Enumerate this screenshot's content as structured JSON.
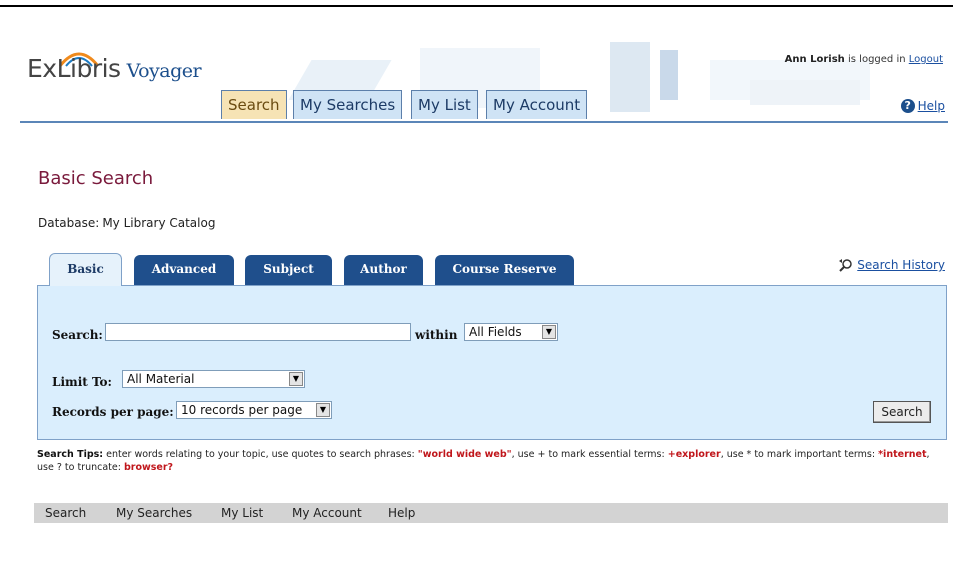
{
  "header": {
    "logo_exlibris": "ExLibris",
    "logo_voyager": "Voyager",
    "login_user": "Ann Lorish",
    "login_text": "is logged in",
    "logout_link": "Logout",
    "help_link": "Help",
    "tabs": [
      {
        "label": "Search",
        "active": true
      },
      {
        "label": "My Searches",
        "active": false
      },
      {
        "label": "My List",
        "active": false
      },
      {
        "label": "My Account",
        "active": false
      }
    ]
  },
  "main": {
    "title": "Basic Search",
    "database_label": "Database:",
    "database_value": "My Library Catalog",
    "search_history_link": "Search History",
    "form_tabs": [
      {
        "label": "Basic",
        "active": true
      },
      {
        "label": "Advanced",
        "active": false
      },
      {
        "label": "Subject",
        "active": false
      },
      {
        "label": "Author",
        "active": false
      },
      {
        "label": "Course Reserve",
        "active": false
      }
    ],
    "search_label": "Search:",
    "search_value": "",
    "within_label": "within",
    "within_selected": "All Fields",
    "limit_label": "Limit To:",
    "limit_selected": "All Material",
    "records_label": "Records per page:",
    "records_selected": "10 records per page",
    "search_button": "Search"
  },
  "tips": {
    "label": "Search Tips:",
    "t1": "enter words relating to your topic, use quotes to search phrases:",
    "e1": "\"world wide web\"",
    "t2": ", use + to mark essential terms:",
    "e2": "+explorer",
    "t3": ", use * to mark important terms:",
    "e3": "*internet",
    "t4": ", use ? to truncate:",
    "e4": "browser?"
  },
  "footer": {
    "links": [
      "Search",
      "My Searches",
      "My List",
      "My Account",
      "Help"
    ]
  },
  "colors": {
    "accent": "#1f4f8c",
    "panel": "#daeefd",
    "title": "#7a1a3c",
    "active_tab": "#f6e3b5",
    "tip_highlight": "#c0161b"
  }
}
